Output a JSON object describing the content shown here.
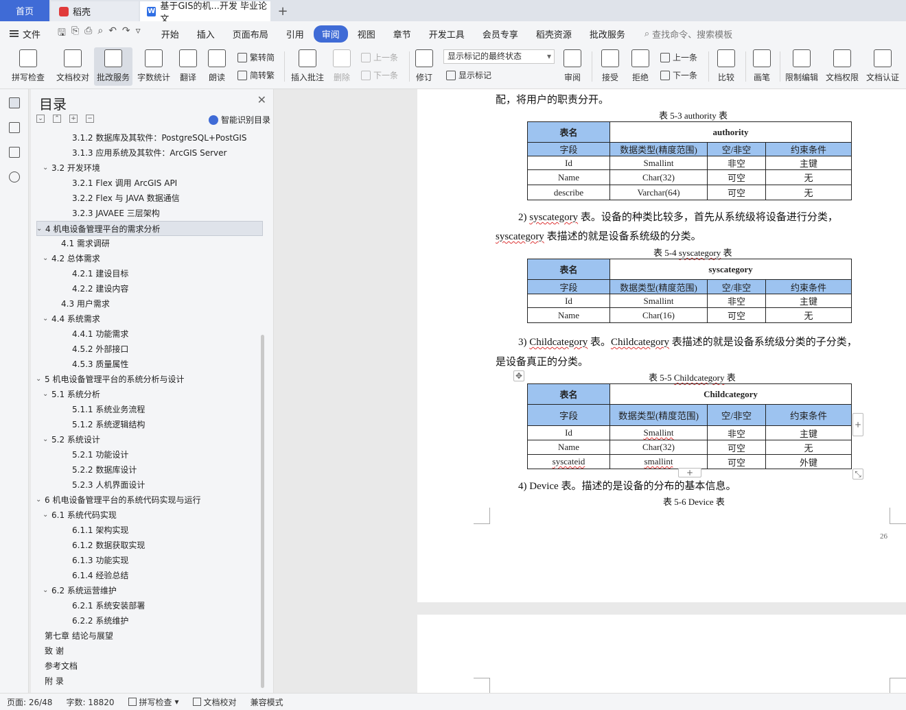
{
  "tabs": {
    "home": "首页",
    "daoke": "稻壳",
    "doc": "基于GIS的机...开发 毕业论文",
    "add": "+"
  },
  "menu": {
    "file": "文件",
    "items": [
      "开始",
      "插入",
      "页面布局",
      "引用",
      "审阅",
      "视图",
      "章节",
      "开发工具",
      "会员专享",
      "稻壳资源",
      "批改服务"
    ],
    "active": "审阅",
    "search": "查找命令、搜索模板"
  },
  "ribbon": {
    "spell": "拼写检查",
    "proof": "文档校对",
    "review_service": "批改服务",
    "wordcount": "字数统计",
    "translate": "翻译",
    "read": "朗读",
    "trad": "繁转简",
    "simp": "简转繁",
    "insert_comment": "插入批注",
    "delete": "删除",
    "prev": "上一条",
    "next": "下一条",
    "track": "修订",
    "markup_state": "显示标记的最终状态",
    "show_markup": "显示标记",
    "review": "审阅",
    "accept": "接受",
    "reject": "拒绝",
    "prev2": "上一条",
    "next2": "下一条",
    "compare": "比较",
    "pen": "画笔",
    "restrict": "限制编辑",
    "perm": "文档权限",
    "cert": "文档认证"
  },
  "toc": {
    "title": "目录",
    "smart": "智能识别目录",
    "items": [
      "3.1.2  数据库及其软件：PostgreSQL+PostGIS",
      "3.1.3  应用系统及其软件：ArcGIS Server",
      "3.2  开发环境",
      "3.2.1 Flex 调用 ArcGIS API",
      "3.2.2 Flex 与 JAVA 数据通信",
      "3.2.3 JAVAEE 三层架构",
      "4  机电设备管理平台的需求分析",
      "4.1  需求调研",
      "4.2  总体需求",
      "4.2.1  建设目标",
      "4.2.2  建设内容",
      "4.3  用户需求",
      "4.4  系统需求",
      "4.4.1  功能需求",
      "4.5.2  外部接口",
      "4.5.3  质量属性",
      "5  机电设备管理平台的系统分析与设计",
      "5.1  系统分析",
      "5.1.1  系统业务流程",
      "5.1.2  系统逻辑结构",
      "5.2  系统设计",
      "5.2.1  功能设计",
      "5.2.2  数据库设计",
      "5.2.3  人机界面设计",
      "6  机电设备管理平台的系统代码实现与运行",
      "6.1  系统代码实现",
      "6.1.1  架构实现",
      "6.1.2  数据获取实现",
      "6.1.3  功能实现",
      "6.1.4  经验总结",
      "6.2  系统运营维护",
      "6.2.1  系统安装部署",
      "6.2.2  系统维护",
      "第七章    结论与展望",
      "致    谢",
      "参考文档",
      "附    录"
    ]
  },
  "doc": {
    "line1": "配，将用户的职责分开。",
    "cap53": "表 5-3    authority 表",
    "t53_name_label": "表名",
    "t53_name": "authority",
    "col_field": "字段",
    "col_type": "数据类型(精度范围)",
    "col_null": "空/非空",
    "col_cons": "约束条件",
    "t53_rows": [
      [
        "Id",
        "Smallint",
        "非空",
        "主键"
      ],
      [
        "Name",
        "Char(32)",
        "可空",
        "无"
      ],
      [
        "describe",
        "Varchar(64)",
        "可空",
        "无"
      ]
    ],
    "p2a_num": "2) ",
    "p2a_word": "syscategory",
    "p2a_rest": " 表。设备的种类比较多，首先从系统级将设备进行分类，",
    "p2b_word": "syscategory",
    "p2b_rest": " 表描述的就是设备系统级的分类。",
    "cap54_pre": "表 5-4    ",
    "cap54_word": "syscategory",
    "cap54_post": " 表",
    "t54_name": "syscategory",
    "t54_rows": [
      [
        "Id",
        "Smallint",
        "非空",
        "主键"
      ],
      [
        "Name",
        "Char(16)",
        "可空",
        "无"
      ]
    ],
    "p3a_num": "3) ",
    "p3a_word1": "Childcategory",
    "p3a_mid": " 表。",
    "p3a_word2": "Childcategory",
    "p3a_rest": " 表描述的就是设备系统级分类的子分类，",
    "p3b": "是设备真正的分类。",
    "cap55_pre": "表 5-5    ",
    "cap55_word": "Childcategory",
    "cap55_post": " 表",
    "t55_name": "Childcategory",
    "t55_rows": [
      [
        "Id",
        "Smallint",
        "非空",
        "主键"
      ],
      [
        "Name",
        "Char(32)",
        "可空",
        "无"
      ],
      [
        "syscateid",
        "smallint",
        "可空",
        "外键"
      ]
    ],
    "p4": "4) Device 表。描述的是设备的分布的基本信息。",
    "cap56": "表 5-6    Device 表",
    "page_num": "26"
  },
  "status": {
    "page": "页面: 26/48",
    "words": "字数: 18820",
    "spell": "拼写检查",
    "proof": "文档校对",
    "compat": "兼容模式"
  }
}
